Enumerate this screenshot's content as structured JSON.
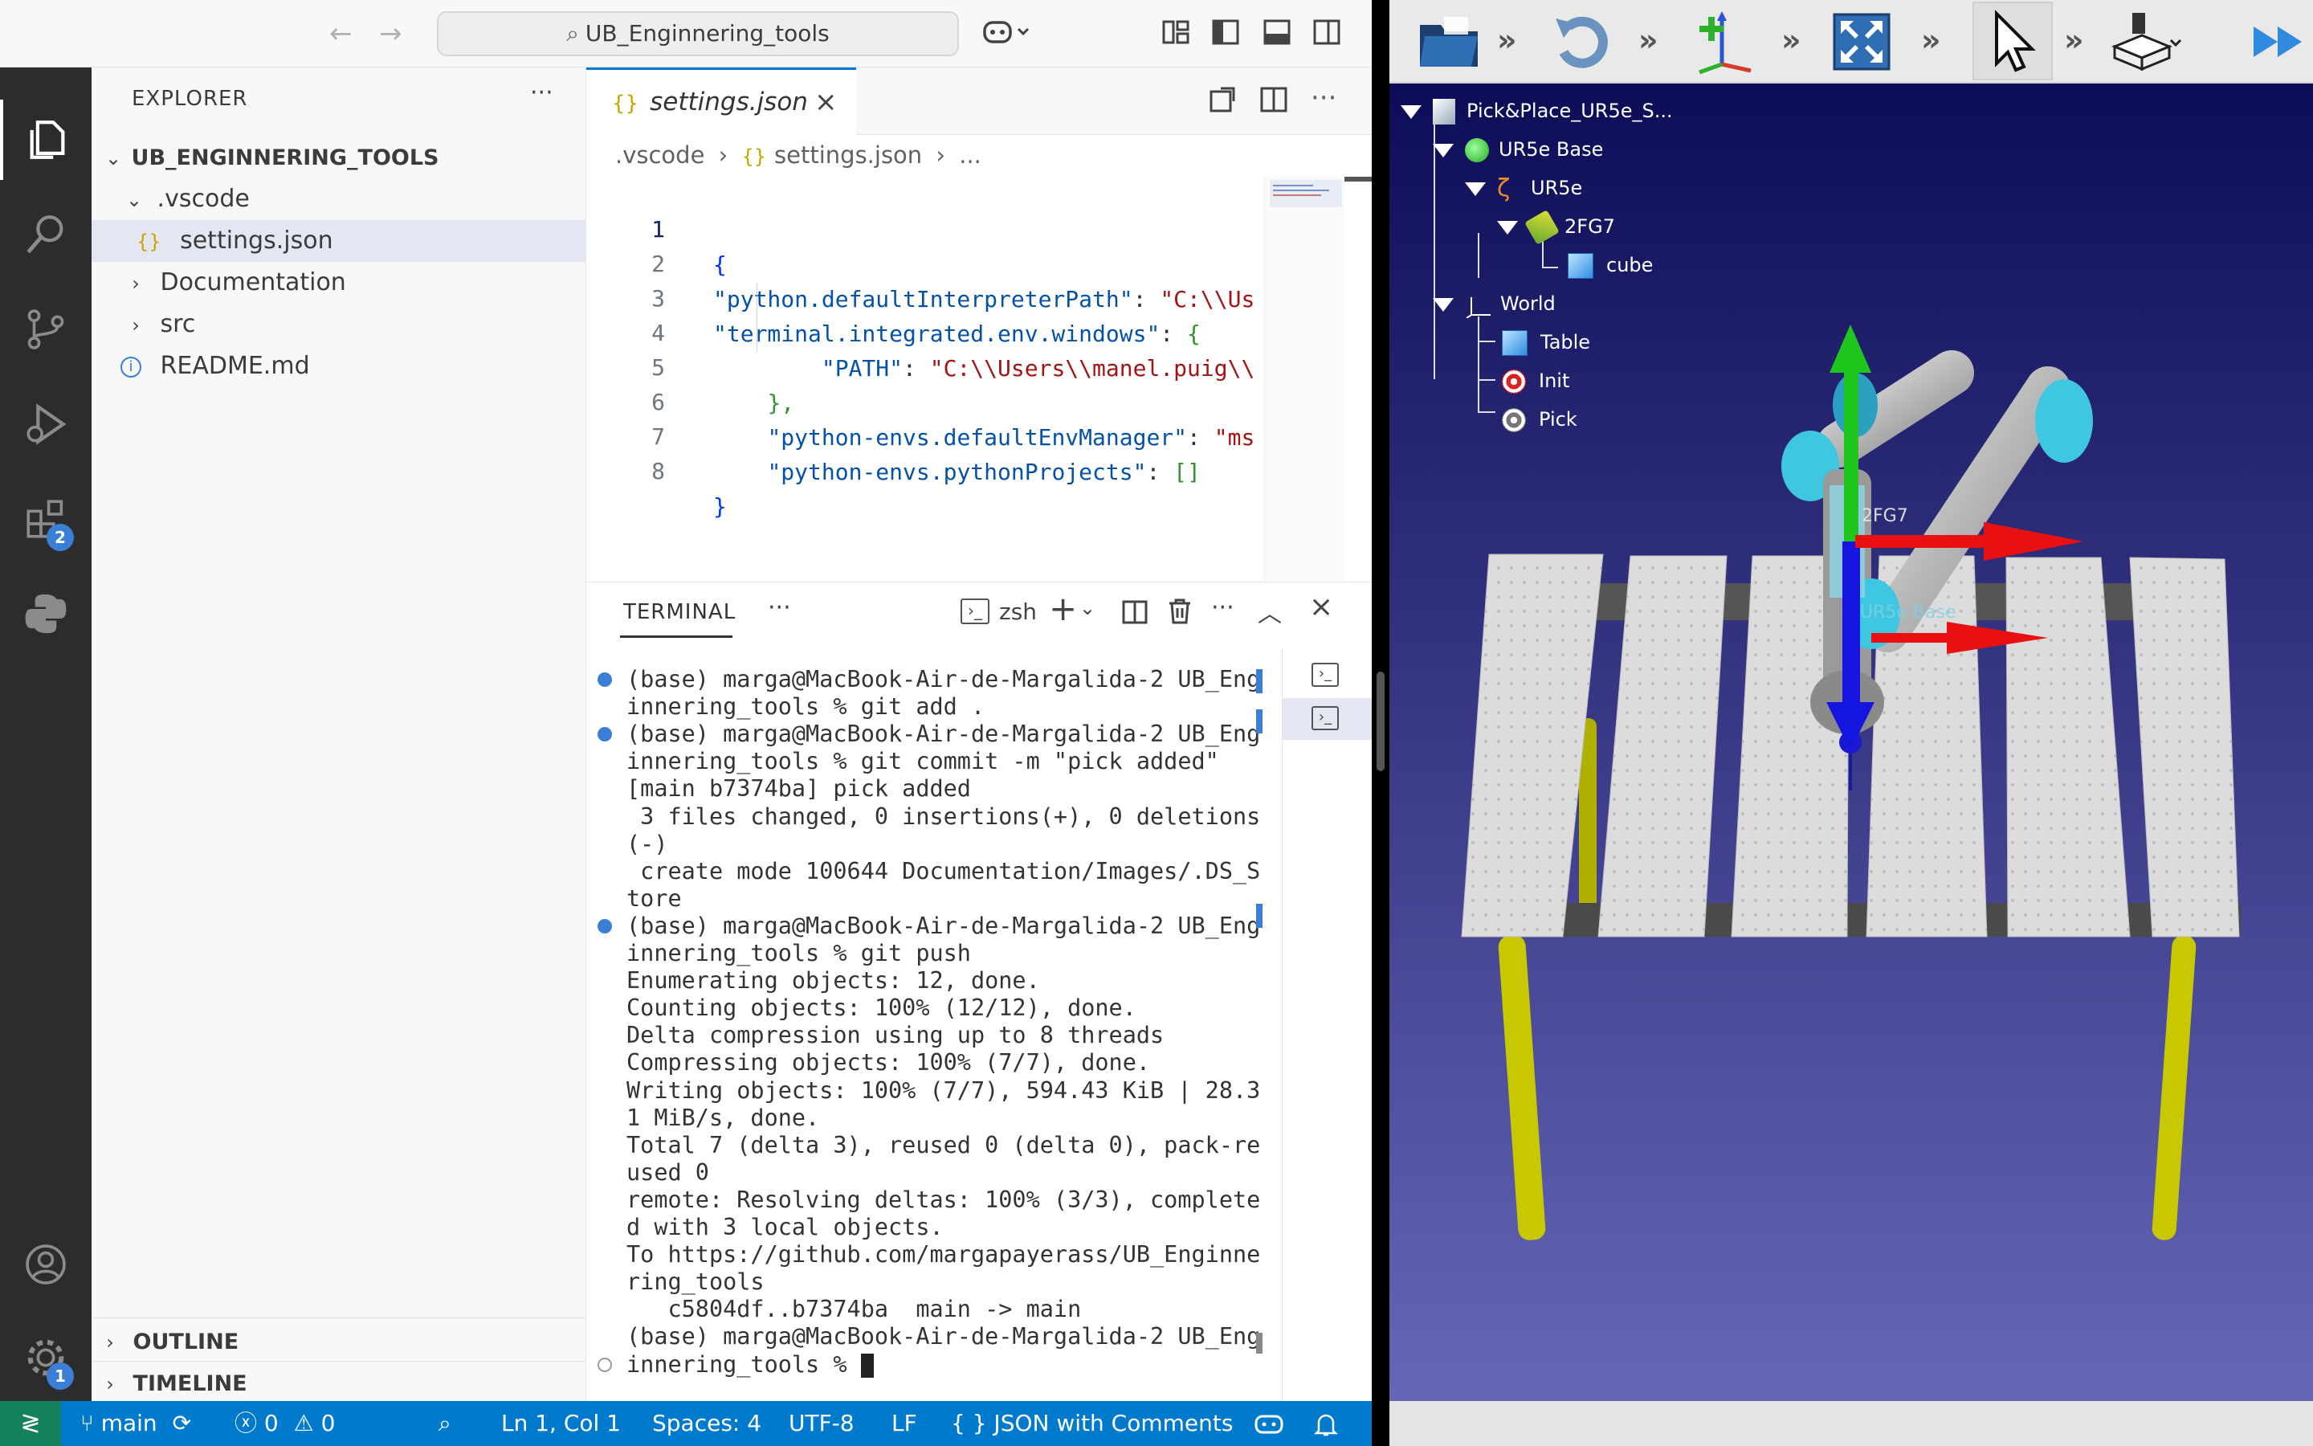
{
  "titlebar": {
    "search_text": "UB_Enginnering_tools"
  },
  "activity_bar": {
    "extensions_badge": "2",
    "settings_badge": "1"
  },
  "explorer": {
    "title": "EXPLORER",
    "more": "···",
    "root": "UB_ENGINNERING_TOOLS",
    "items": [
      {
        "label": ".vscode",
        "kind": "folder-open"
      },
      {
        "label": "settings.json",
        "kind": "json-file",
        "selected": true
      },
      {
        "label": "Documentation",
        "kind": "folder"
      },
      {
        "label": "src",
        "kind": "folder"
      },
      {
        "label": "README.md",
        "kind": "info-file"
      }
    ],
    "outline": "OUTLINE",
    "timeline": "TIMELINE"
  },
  "editor": {
    "tab_label": "settings.json",
    "tab_icon": "{}",
    "breadcrumb": [
      ".vscode",
      "settings.json",
      "..."
    ],
    "lines": [
      {
        "n": "1",
        "text": "{"
      },
      {
        "n": "2",
        "key": "\"python.defaultInterpreterPath\"",
        "sep": ": ",
        "val": "\"C:\\\\Us"
      },
      {
        "n": "3",
        "key": "\"terminal.integrated.env.windows\"",
        "sep": ": ",
        "val": "{"
      },
      {
        "n": "4",
        "indent": "        ",
        "key": "\"PATH\"",
        "sep": ": ",
        "val": "\"C:\\\\Users\\\\manel.puig\\\\"
      },
      {
        "n": "5",
        "indent": "    ",
        "text": "},"
      },
      {
        "n": "6",
        "indent": "    ",
        "key": "\"python-envs.defaultEnvManager\"",
        "sep": ": ",
        "val": "\"ms"
      },
      {
        "n": "7",
        "indent": "    ",
        "key": "\"python-envs.pythonProjects\"",
        "sep": ": ",
        "val": "[]"
      },
      {
        "n": "8",
        "text": "}"
      }
    ]
  },
  "terminal": {
    "tab": "TERMINAL",
    "more": "···",
    "shell": "zsh",
    "lines": [
      {
        "text": "(base) marga@MacBook-Air-de-Margalida-2 UB_Eng",
        "dot": "blue"
      },
      {
        "text": "innering_tools % git add ."
      },
      {
        "text": "(base) marga@MacBook-Air-de-Margalida-2 UB_Eng",
        "dot": "blue"
      },
      {
        "text": "innering_tools % git commit -m \"pick added\""
      },
      {
        "text": "[main b7374ba] pick added"
      },
      {
        "text": " 3 files changed, 0 insertions(+), 0 deletions"
      },
      {
        "text": "(-)"
      },
      {
        "text": " create mode 100644 Documentation/Images/.DS_S"
      },
      {
        "text": "tore"
      },
      {
        "text": "(base) marga@MacBook-Air-de-Margalida-2 UB_Eng",
        "dot": "blue"
      },
      {
        "text": "innering_tools % git push"
      },
      {
        "text": "Enumerating objects: 12, done."
      },
      {
        "text": "Counting objects: 100% (12/12), done."
      },
      {
        "text": "Delta compression using up to 8 threads"
      },
      {
        "text": "Compressing objects: 100% (7/7), done."
      },
      {
        "text": "Writing objects: 100% (7/7), 594.43 KiB | 28.3"
      },
      {
        "text": "1 MiB/s, done."
      },
      {
        "text": "Total 7 (delta 3), reused 0 (delta 0), pack-re"
      },
      {
        "text": "used 0"
      },
      {
        "text": "remote: Resolving deltas: 100% (3/3), complete"
      },
      {
        "text": "d with 3 local objects."
      },
      {
        "text": "To https://github.com/margapayerass/UB_Enginne"
      },
      {
        "text": "ring_tools"
      },
      {
        "text": "   c5804df..b7374ba  main -> main"
      },
      {
        "text": "(base) marga@MacBook-Air-de-Margalida-2 UB_Eng"
      },
      {
        "text": "innering_tools % ",
        "cursor": true,
        "dot": "hollow"
      }
    ]
  },
  "statusbar": {
    "branch": "main",
    "errors": "0",
    "warnings": "0",
    "position": "Ln 1, Col 1",
    "spaces": "Spaces: 4",
    "encoding": "UTF-8",
    "eol": "LF",
    "language": "{ }  JSON with Comments"
  },
  "simulator": {
    "tree": [
      {
        "label": "Pick&Place_UR5e_S...",
        "level": 0,
        "icon": "scene-icon"
      },
      {
        "label": "UR5e Base",
        "level": 1,
        "icon": "base-icon"
      },
      {
        "label": "UR5e",
        "level": 2,
        "icon": "robot-arm-icon"
      },
      {
        "label": "2FG7",
        "level": 3,
        "icon": "gripper-icon"
      },
      {
        "label": "cube",
        "level": 4,
        "icon": "cube-icon"
      },
      {
        "label": "World",
        "level": 1,
        "icon": "axes-icon"
      },
      {
        "label": "Table",
        "level": 2,
        "icon": "cube-icon"
      },
      {
        "label": "Init",
        "level": 2,
        "icon": "target-icon"
      },
      {
        "label": "Pick",
        "level": 2,
        "icon": "target-icon"
      }
    ],
    "overlay_labels": [
      "2FG7",
      "UR5e Base"
    ],
    "colors": {
      "bg_top": "#0d0d57",
      "bg_bottom": "#6666b8"
    }
  }
}
